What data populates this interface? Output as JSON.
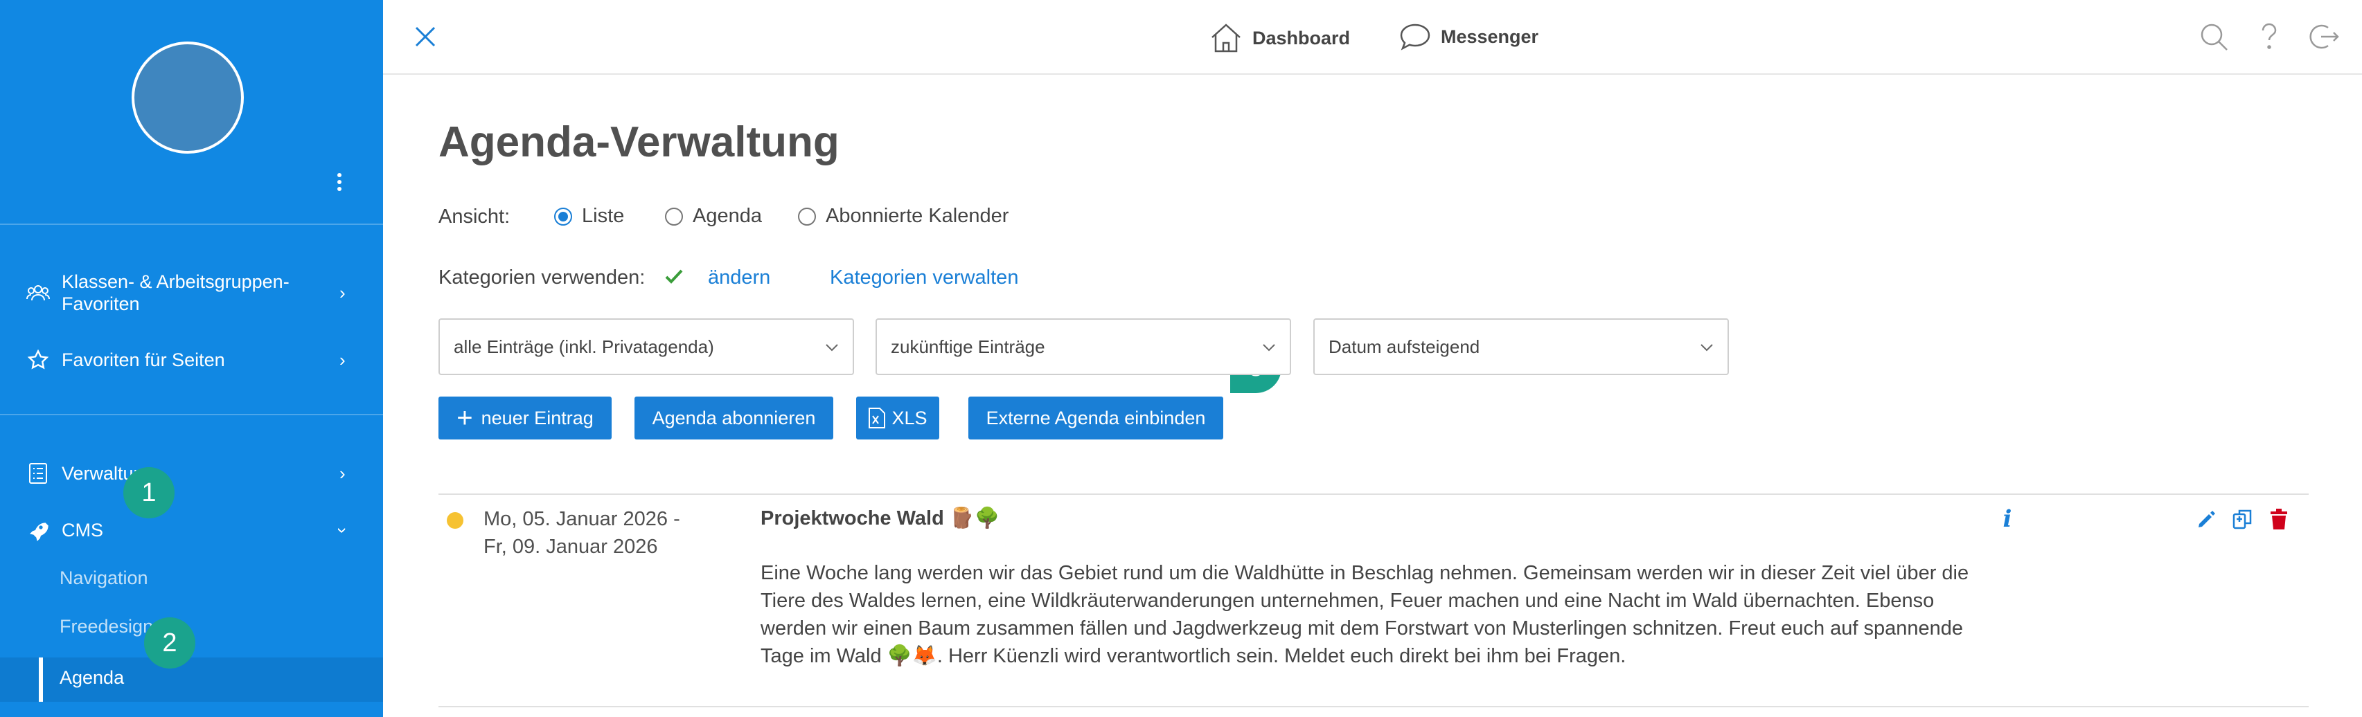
{
  "sidebar": {
    "items": [
      {
        "label": "Klassen- & Arbeitsgruppen-Favoriten",
        "icon": "group-icon"
      },
      {
        "label": "Favoriten für Seiten",
        "icon": "star-icon"
      },
      {
        "label": "Verwaltung",
        "icon": "list-icon"
      },
      {
        "label": "CMS",
        "icon": "rocket-icon"
      }
    ],
    "cms_sub": [
      {
        "label": "Navigation"
      },
      {
        "label": "Freedesign"
      },
      {
        "label": "Agenda",
        "active": true
      }
    ]
  },
  "badges": [
    "1",
    "2",
    "3"
  ],
  "topbar": {
    "dashboard": "Dashboard",
    "messenger": "Messenger"
  },
  "page": {
    "title": "Agenda-Verwaltung",
    "view_label": "Ansicht:",
    "view_options": [
      "Liste",
      "Agenda",
      "Abonnierte Kalender"
    ],
    "view_selected": "Liste",
    "categories_label": "Kategorien verwenden:",
    "categories_change": "ändern",
    "categories_manage": "Kategorien verwalten"
  },
  "filters": {
    "scope": "alle Einträge (inkl. Privatagenda)",
    "time": "zukünftige Einträge",
    "sort": "Datum aufsteigend"
  },
  "buttons": {
    "new_entry": "neuer Eintrag",
    "subscribe": "Agenda abonnieren",
    "xls": "XLS",
    "external": "Externe Agenda einbinden"
  },
  "entry": {
    "date_line1": "Mo, 05. Januar 2026 -",
    "date_line2": "Fr, 09. Januar 2026",
    "title": "Projektwoche Wald 🪵🌳",
    "description": "Eine Woche lang werden wir das Gebiet rund um die Waldhütte in Beschlag nehmen. Gemeinsam werden wir in dieser Zeit viel über die Tiere des Waldes lernen, eine Wildkräuterwanderungen unternehmen, Feuer machen und eine Nacht im Wald übernachten. Ebenso werden wir einen Baum zusammen fällen und Jagdwerkzeug mit dem Forstwart von Musterlingen schnitzen. Freut euch auf spannende Tage im Wald 🌳🦊. Herr Küenzli wird verantwortlich sein. Meldet euch direkt bei ihm bei Fragen.",
    "status_color": "#f6c232"
  },
  "colors": {
    "sidebar": "#1188e3",
    "accent": "#1a7fd6",
    "badge": "#1aa38d",
    "delete": "#d0021b"
  }
}
